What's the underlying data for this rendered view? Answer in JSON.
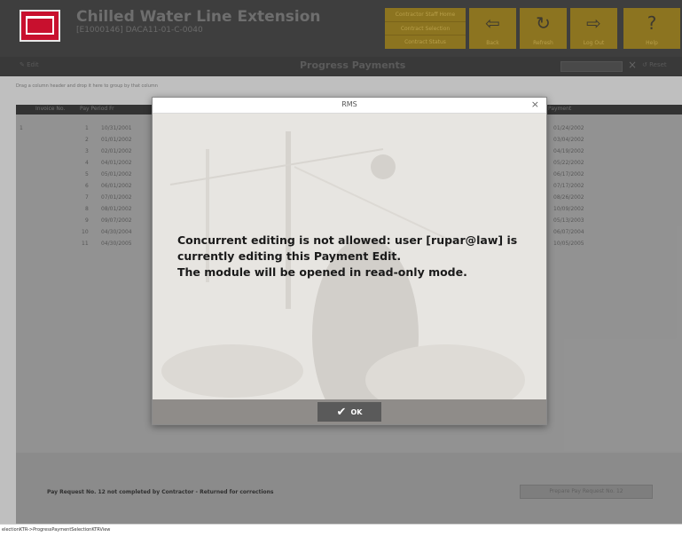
{
  "app": {
    "title": "Chilled Water Line Extension",
    "subtitle": "[E1000146] DACA11-01-C-0040",
    "logo_text": "USACE"
  },
  "header_links": [
    "Contractor Staff Home",
    "Contract Selection",
    "Contract Status"
  ],
  "header_buttons": [
    {
      "label": "Back",
      "icon": "back-arrow-icon"
    },
    {
      "label": "Refresh",
      "icon": "refresh-icon"
    },
    {
      "label": "Log Out",
      "icon": "logout-icon"
    },
    {
      "label": "Help",
      "icon": "help-icon"
    }
  ],
  "toolbar": {
    "edit_label": "Edit",
    "title": "Progress Payments",
    "clear_label": "×",
    "reset_label": "Reset"
  },
  "hint_text": "Drag a column header and drop it here to group by that column",
  "grid": {
    "columns": [
      "Invoice No.",
      "Pay Period Fr",
      "Payment"
    ],
    "rows": [
      {
        "no": "1",
        "date": "10/31/2001",
        "payment": "01/24/2002"
      },
      {
        "no": "2",
        "date": "01/01/2002",
        "payment": "03/04/2002"
      },
      {
        "no": "3",
        "date": "02/01/2002",
        "payment": "04/19/2002"
      },
      {
        "no": "4",
        "date": "04/01/2002",
        "payment": "05/22/2002"
      },
      {
        "no": "5",
        "date": "05/01/2002",
        "payment": "06/17/2002"
      },
      {
        "no": "6",
        "date": "06/01/2002",
        "payment": "07/17/2002"
      },
      {
        "no": "7",
        "date": "07/01/2002",
        "payment": "08/26/2002"
      },
      {
        "no": "8",
        "date": "08/01/2002",
        "payment": "10/09/2002"
      },
      {
        "no": "9",
        "date": "09/07/2002",
        "payment": "05/13/2003"
      },
      {
        "no": "10",
        "date": "04/30/2004",
        "payment": "06/07/2004"
      },
      {
        "no": "11",
        "date": "04/30/2005",
        "payment": "10/05/2005"
      }
    ]
  },
  "footer": {
    "message": "Pay Request No. 12 not completed by Contractor - Returned for corrections",
    "prepare_button": "Prepare Pay Request No. 12"
  },
  "status_bar": "electionKTR->ProgressPaymentSelectionKTRView",
  "dialog": {
    "title": "RMS",
    "close": "×",
    "message_lines": [
      "Concurrent editing is not allowed: user [rupar@law] is",
      "currently editing this Payment Edit.",
      "The module will be opened in read-only mode."
    ],
    "ok_label": "OK"
  },
  "colors": {
    "header_bg": "#3e3e3e",
    "accent_gold": "#8c7420",
    "logo_red": "#c8102e"
  }
}
